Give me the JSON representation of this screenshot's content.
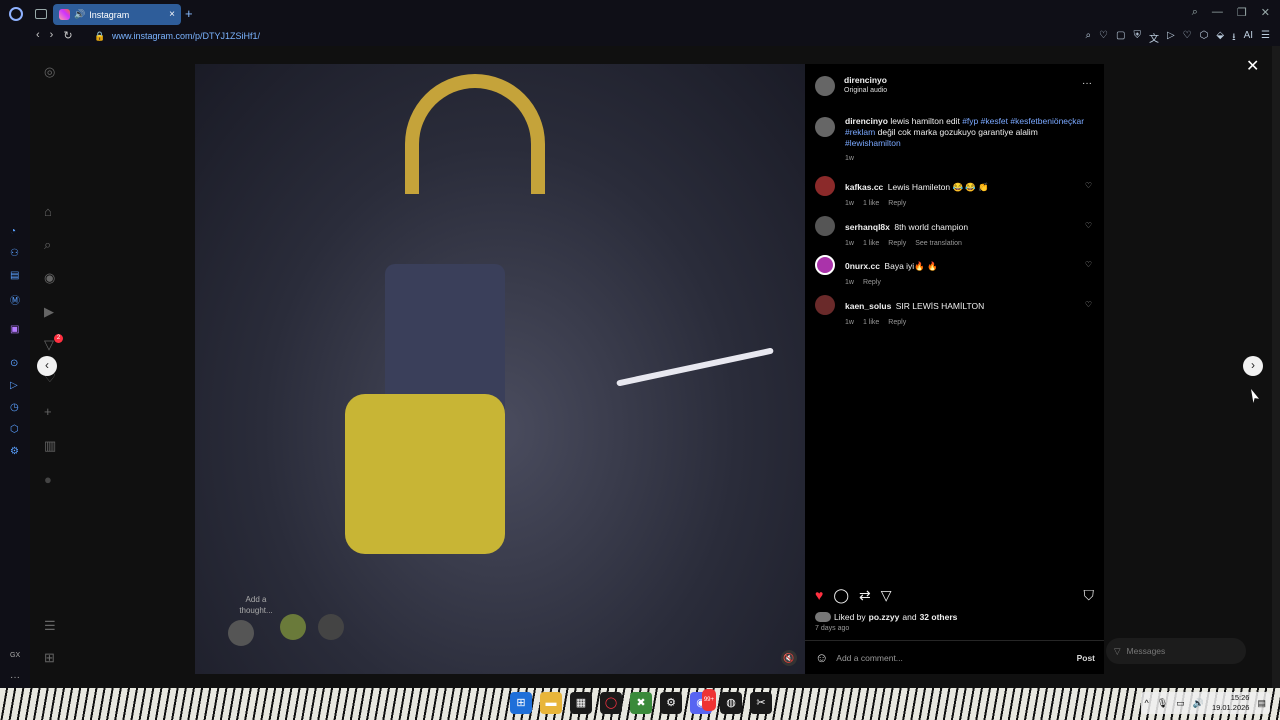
{
  "browser": {
    "tab_title": "Instagram",
    "tab_close": "×",
    "new_tab": "+",
    "url": "www.instagram.com/p/DTYJ1ZSiHf1/",
    "ai_label": "AI",
    "window_controls": [
      "⌕",
      "—",
      "❐",
      "✕"
    ],
    "nav": [
      "‹",
      "›",
      "↻"
    ]
  },
  "instagram": {
    "post": {
      "author": "direncinyo",
      "audio": "Original audio",
      "more": "···",
      "caption_user": "direncinyo",
      "caption_text_1": "lewis hamilton edit",
      "caption_tags_1": "#fyp #kesfet #kesfetbeniöneçkar",
      "caption_tags_2": "#reklam",
      "caption_text_2": "değil cok marka gozukuyo garantiye alalim",
      "caption_tags_3": "#lewishamilton",
      "caption_time": "1w",
      "liked_by_prefix": "Liked by",
      "liked_by_user": "po.zzyy",
      "liked_by_and": "and",
      "liked_by_others": "32 others",
      "posted_ago": "7 days ago",
      "comment_placeholder": "Add a comment...",
      "post_button": "Post"
    },
    "comments": [
      {
        "user": "kafkas.cc",
        "text": "Lewis Hamileton 😂 😂 👏",
        "time": "1w",
        "likes": "1 like",
        "reply": "Reply",
        "translate": ""
      },
      {
        "user": "serhanql8x",
        "text": "8th world champion",
        "time": "1w",
        "likes": "1 like",
        "reply": "Reply",
        "translate": "See translation"
      },
      {
        "user": "0nurx.cc",
        "text": "Baya iyi🔥 🔥",
        "time": "1w",
        "likes": "",
        "reply": "Reply",
        "translate": ""
      },
      {
        "user": "kaen_solus",
        "text": "SIR LEWİS HAMİLTON",
        "time": "1w",
        "likes": "1 like",
        "reply": "Reply",
        "translate": ""
      }
    ],
    "thoughts_label": "Add a thought...",
    "messages_label": "Messages",
    "sidebar_badge": "2"
  },
  "taskbar": {
    "time": "15:26",
    "date": "19.01.2026",
    "badge": "99+"
  },
  "colors": {
    "accent": "#2e5d9a",
    "link": "#7aa8ff",
    "like": "#ff3040"
  }
}
